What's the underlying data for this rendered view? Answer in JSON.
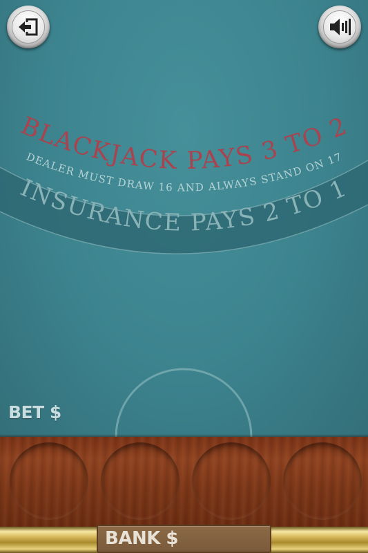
{
  "table": {
    "blackjack_text": "BLACKJACK PAYS 3 TO 2",
    "dealer_rule_text": "DEALER MUST DRAW 16 AND ALWAYS STAND ON 17",
    "insurance_text": "INSURANCE PAYS 2 TO 1",
    "colors": {
      "felt": "#3c838e",
      "blackjack_text": "#a8444f",
      "insurance_band": "#2d6772"
    }
  },
  "controls": {
    "back_icon": "exit-arrow-icon",
    "sound_icon": "speaker-icon"
  },
  "bet": {
    "label": "BET $",
    "amount": ""
  },
  "bank": {
    "label": "BANK $",
    "amount": ""
  },
  "chip_slots": [
    {
      "id": "chip-slot-1"
    },
    {
      "id": "chip-slot-2"
    },
    {
      "id": "chip-slot-3"
    },
    {
      "id": "chip-slot-4"
    }
  ]
}
